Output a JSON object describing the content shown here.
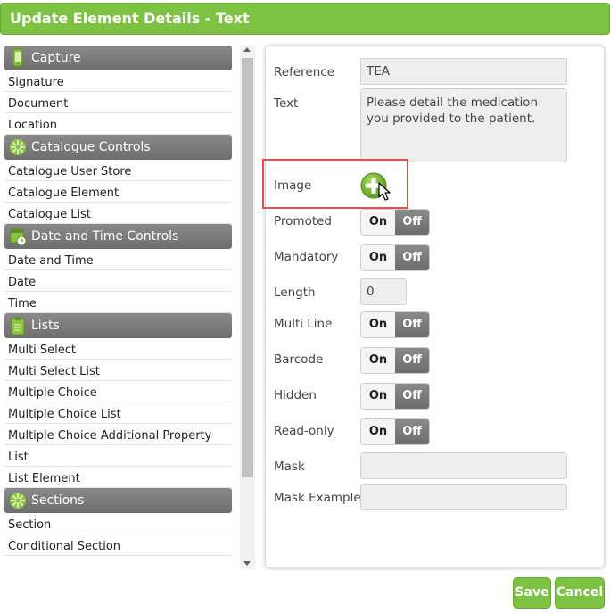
{
  "window": {
    "title": "Update Element Details - Text"
  },
  "sidebar": {
    "sections": [
      {
        "label": "Capture",
        "icon": "phone-icon",
        "items": [
          "Signature",
          "Document",
          "Location"
        ]
      },
      {
        "label": "Catalogue Controls",
        "icon": "catalogue-icon",
        "items": [
          "Catalogue User Store",
          "Catalogue Element",
          "Catalogue List"
        ]
      },
      {
        "label": "Date and Time Controls",
        "icon": "calendar-clock-icon",
        "items": [
          "Date and Time",
          "Date",
          "Time"
        ]
      },
      {
        "label": "Lists",
        "icon": "clipboard-icon",
        "items": [
          "Multi Select",
          "Multi Select List",
          "Multiple Choice",
          "Multiple Choice List",
          "Multiple Choice Additional Property",
          "List",
          "List Element"
        ]
      },
      {
        "label": "Sections",
        "icon": "sections-icon",
        "items": [
          "Section",
          "Conditional Section"
        ]
      }
    ]
  },
  "form": {
    "reference": {
      "label": "Reference",
      "value": "TEA"
    },
    "text": {
      "label": "Text",
      "value": "Please detail the medication you provided to the patient."
    },
    "image": {
      "label": "Image"
    },
    "promoted": {
      "label": "Promoted"
    },
    "mandatory": {
      "label": "Mandatory"
    },
    "length": {
      "label": "Length",
      "value": "0"
    },
    "multiline": {
      "label": "Multi Line"
    },
    "barcode": {
      "label": "Barcode"
    },
    "hidden": {
      "label": "Hidden"
    },
    "readonly": {
      "label": "Read-only"
    },
    "mask": {
      "label": "Mask",
      "value": ""
    },
    "mask_example": {
      "label": "Mask Example",
      "value": ""
    },
    "toggle_on": "On",
    "toggle_off": "Off"
  },
  "footer": {
    "save_label": "Save",
    "cancel_label": "Cancel"
  },
  "colors": {
    "accent": "#7dc242",
    "header_gray": "#7c7c7c",
    "highlight": "#e05050"
  }
}
